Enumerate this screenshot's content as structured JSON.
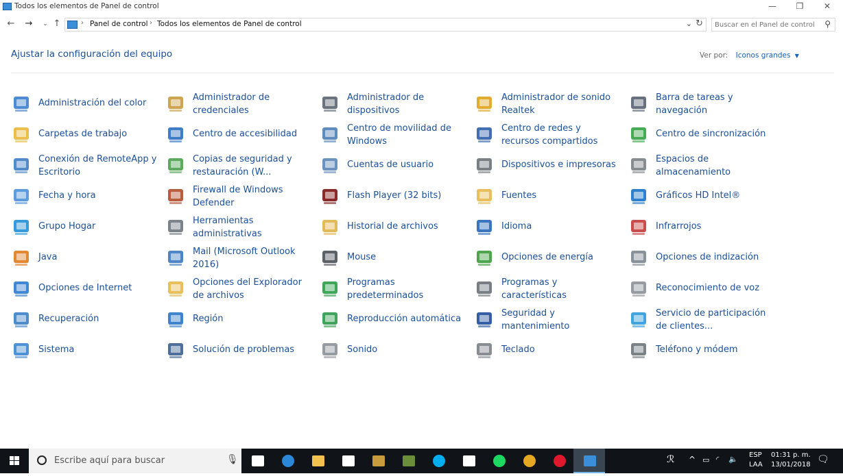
{
  "window": {
    "title": "Todos los elementos de Panel de control",
    "minimize_glyph": "—",
    "restore_glyph": "❐",
    "close_glyph": "✕"
  },
  "address": {
    "crumbs": [
      "Panel de control",
      "Todos los elementos de Panel de control"
    ],
    "search_placeholder": "Buscar en el Panel de control"
  },
  "header": {
    "title": "Ajustar la configuración del equipo",
    "view_by_label": "Ver por:",
    "view_by_value": "Iconos grandes"
  },
  "items": [
    {
      "label": "Administración del color",
      "icon": "color-management-icon",
      "color": "#3a7fd0"
    },
    {
      "label": "Administrador de credenciales",
      "icon": "credential-manager-icon",
      "color": "#c89a3c"
    },
    {
      "label": "Administrador de dispositivos",
      "icon": "device-manager-icon",
      "color": "#5a6470"
    },
    {
      "label": "Administrador de sonido Realtek",
      "icon": "realtek-icon",
      "color": "#e1a21b"
    },
    {
      "label": "Barra de tareas y navegación",
      "icon": "taskbar-icon",
      "color": "#556070"
    },
    {
      "label": "Carpetas de trabajo",
      "icon": "work-folders-icon",
      "color": "#e9b73b"
    },
    {
      "label": "Centro de accesibilidad",
      "icon": "accessibility-icon",
      "color": "#2a6fc0"
    },
    {
      "label": "Centro de movilidad de Windows",
      "icon": "mobility-center-icon",
      "color": "#4d7fb5"
    },
    {
      "label": "Centro de redes y recursos compartidos",
      "icon": "network-center-icon",
      "color": "#2c5fa8"
    },
    {
      "label": "Centro de sincronización",
      "icon": "sync-center-icon",
      "color": "#33a244"
    },
    {
      "label": "Conexión de RemoteApp y Escritorio",
      "icon": "remoteapp-icon",
      "color": "#3f7ec4"
    },
    {
      "label": "Copias de seguridad y restauración (W...",
      "icon": "backup-icon",
      "color": "#4aa24a"
    },
    {
      "label": "Cuentas de usuario",
      "icon": "user-accounts-icon",
      "color": "#5c86b8"
    },
    {
      "label": "Dispositivos e impresoras",
      "icon": "printers-icon",
      "color": "#6c7379"
    },
    {
      "label": "Espacios de almacenamiento",
      "icon": "storage-spaces-icon",
      "color": "#7a7f85"
    },
    {
      "label": "Fecha y hora",
      "icon": "date-time-icon",
      "color": "#4a90d9"
    },
    {
      "label": "Firewall de Windows Defender",
      "icon": "firewall-icon",
      "color": "#b24a2a"
    },
    {
      "label": "Flash Player (32 bits)",
      "icon": "flash-icon",
      "color": "#7d1414"
    },
    {
      "label": "Fuentes",
      "icon": "fonts-icon",
      "color": "#e6b84a"
    },
    {
      "label": "Gráficos HD Intel®",
      "icon": "intel-graphics-icon",
      "color": "#1a73c6"
    },
    {
      "label": "Grupo Hogar",
      "icon": "homegroup-icon",
      "color": "#1e8fd8"
    },
    {
      "label": "Herramientas administrativas",
      "icon": "admin-tools-icon",
      "color": "#6d7680"
    },
    {
      "label": "Historial de archivos",
      "icon": "file-history-icon",
      "color": "#e0b347"
    },
    {
      "label": "Idioma",
      "icon": "language-icon",
      "color": "#2367b8"
    },
    {
      "label": "Infrarrojos",
      "icon": "infrared-icon",
      "color": "#c43a3a"
    },
    {
      "label": "Java",
      "icon": "java-icon",
      "color": "#e07b1c"
    },
    {
      "label": "Mail (Microsoft Outlook 2016)",
      "icon": "mail-icon",
      "color": "#3a78c0"
    },
    {
      "label": "Mouse",
      "icon": "mouse-icon",
      "color": "#4a5058"
    },
    {
      "label": "Opciones de energía",
      "icon": "power-options-icon",
      "color": "#3a9c3a"
    },
    {
      "label": "Opciones de indización",
      "icon": "indexing-icon",
      "color": "#7c8590"
    },
    {
      "label": "Opciones de Internet",
      "icon": "internet-options-icon",
      "color": "#2b7ad0"
    },
    {
      "label": "Opciones del Explorador de archivos",
      "icon": "explorer-options-icon",
      "color": "#e5b848"
    },
    {
      "label": "Programas predeterminados",
      "icon": "default-programs-icon",
      "color": "#2a9d47"
    },
    {
      "label": "Programas y características",
      "icon": "programs-features-icon",
      "color": "#6a7078"
    },
    {
      "label": "Reconocimiento de voz",
      "icon": "speech-icon",
      "color": "#8a9097"
    },
    {
      "label": "Recuperación",
      "icon": "recovery-icon",
      "color": "#3a7fc8"
    },
    {
      "label": "Región",
      "icon": "region-icon",
      "color": "#2b76c8"
    },
    {
      "label": "Reproducción automática",
      "icon": "autoplay-icon",
      "color": "#2e9a4a"
    },
    {
      "label": "Seguridad y mantenimiento",
      "icon": "security-maintenance-icon",
      "color": "#1f4e9a"
    },
    {
      "label": "Servicio de participación de clientes...",
      "icon": "customer-experience-icon",
      "color": "#2d9ad8"
    },
    {
      "label": "Sistema",
      "icon": "system-icon",
      "color": "#3a86d0"
    },
    {
      "label": "Solución de problemas",
      "icon": "troubleshooting-icon",
      "color": "#3a5f8f"
    },
    {
      "label": "Sonido",
      "icon": "sound-icon",
      "color": "#8b9097"
    },
    {
      "label": "Teclado",
      "icon": "keyboard-icon",
      "color": "#7b8087"
    },
    {
      "label": "Teléfono y módem",
      "icon": "phone-modem-icon",
      "color": "#6c737a"
    }
  ],
  "taskbar": {
    "search_placeholder": "Escribe aquí para buscar",
    "apps": [
      {
        "name": "task-view-icon",
        "color": "#ffffff"
      },
      {
        "name": "edge-icon",
        "color": "#2b87d8"
      },
      {
        "name": "file-explorer-icon",
        "color": "#f2c14e"
      },
      {
        "name": "store-icon",
        "color": "#ffffff"
      },
      {
        "name": "league-icon",
        "color": "#c89b3c"
      },
      {
        "name": "minecraft-icon",
        "color": "#6b8e3a"
      },
      {
        "name": "skype-icon",
        "color": "#00aff0"
      },
      {
        "name": "mail-app-icon",
        "color": "#ffffff"
      },
      {
        "name": "spotify-icon",
        "color": "#1ed760"
      },
      {
        "name": "chrome-icon",
        "color": "#e5a823"
      },
      {
        "name": "opera-icon",
        "color": "#e0182d"
      },
      {
        "name": "control-panel-icon",
        "color": "#3b8ed8"
      }
    ],
    "tray": {
      "people": "ℛ",
      "language_top": "ESP",
      "language_bottom": "LAA",
      "time": "01:31 p. m.",
      "date": "13/01/2018"
    }
  }
}
